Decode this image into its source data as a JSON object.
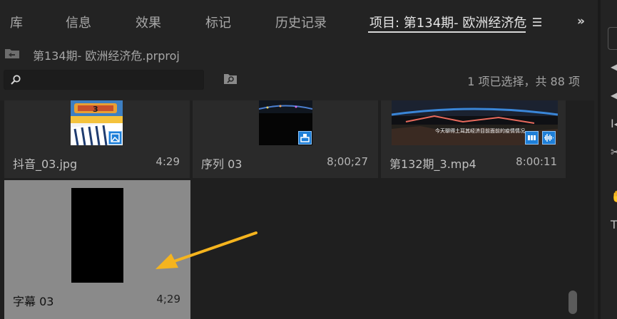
{
  "tabs": [
    {
      "label": "库"
    },
    {
      "label": "信息"
    },
    {
      "label": "效果"
    },
    {
      "label": "标记"
    },
    {
      "label": "历史记录"
    },
    {
      "label": "项目: 第134期- 欧洲经济危"
    }
  ],
  "overflow_label": "»",
  "project": {
    "path": "第134期- 欧洲经济危.prproj"
  },
  "search": {
    "placeholder": "",
    "value": ""
  },
  "selection_status": "1 项已选择，共 88 项",
  "items": [
    {
      "name": "抖音_03.jpg",
      "duration": "4:29"
    },
    {
      "name": "序列 03",
      "duration": "8;00;27"
    },
    {
      "name": "第132期_3.mp4",
      "duration": "8:00:11"
    },
    {
      "name": "字幕 03",
      "duration": "4;29"
    }
  ],
  "thumb_number": "3",
  "thumb_subtitle": "今天聊得土耳其经济目前面前的疫情情况",
  "colors": {
    "background": "#232323",
    "selected_tile": "#8a8a8a",
    "badge_blue": "#1e7fd8",
    "arrow": "#f5b41e"
  },
  "right_panel_glyphs": [
    "◀",
    "◀",
    "I◀",
    "✂",
    "✋",
    "T"
  ]
}
